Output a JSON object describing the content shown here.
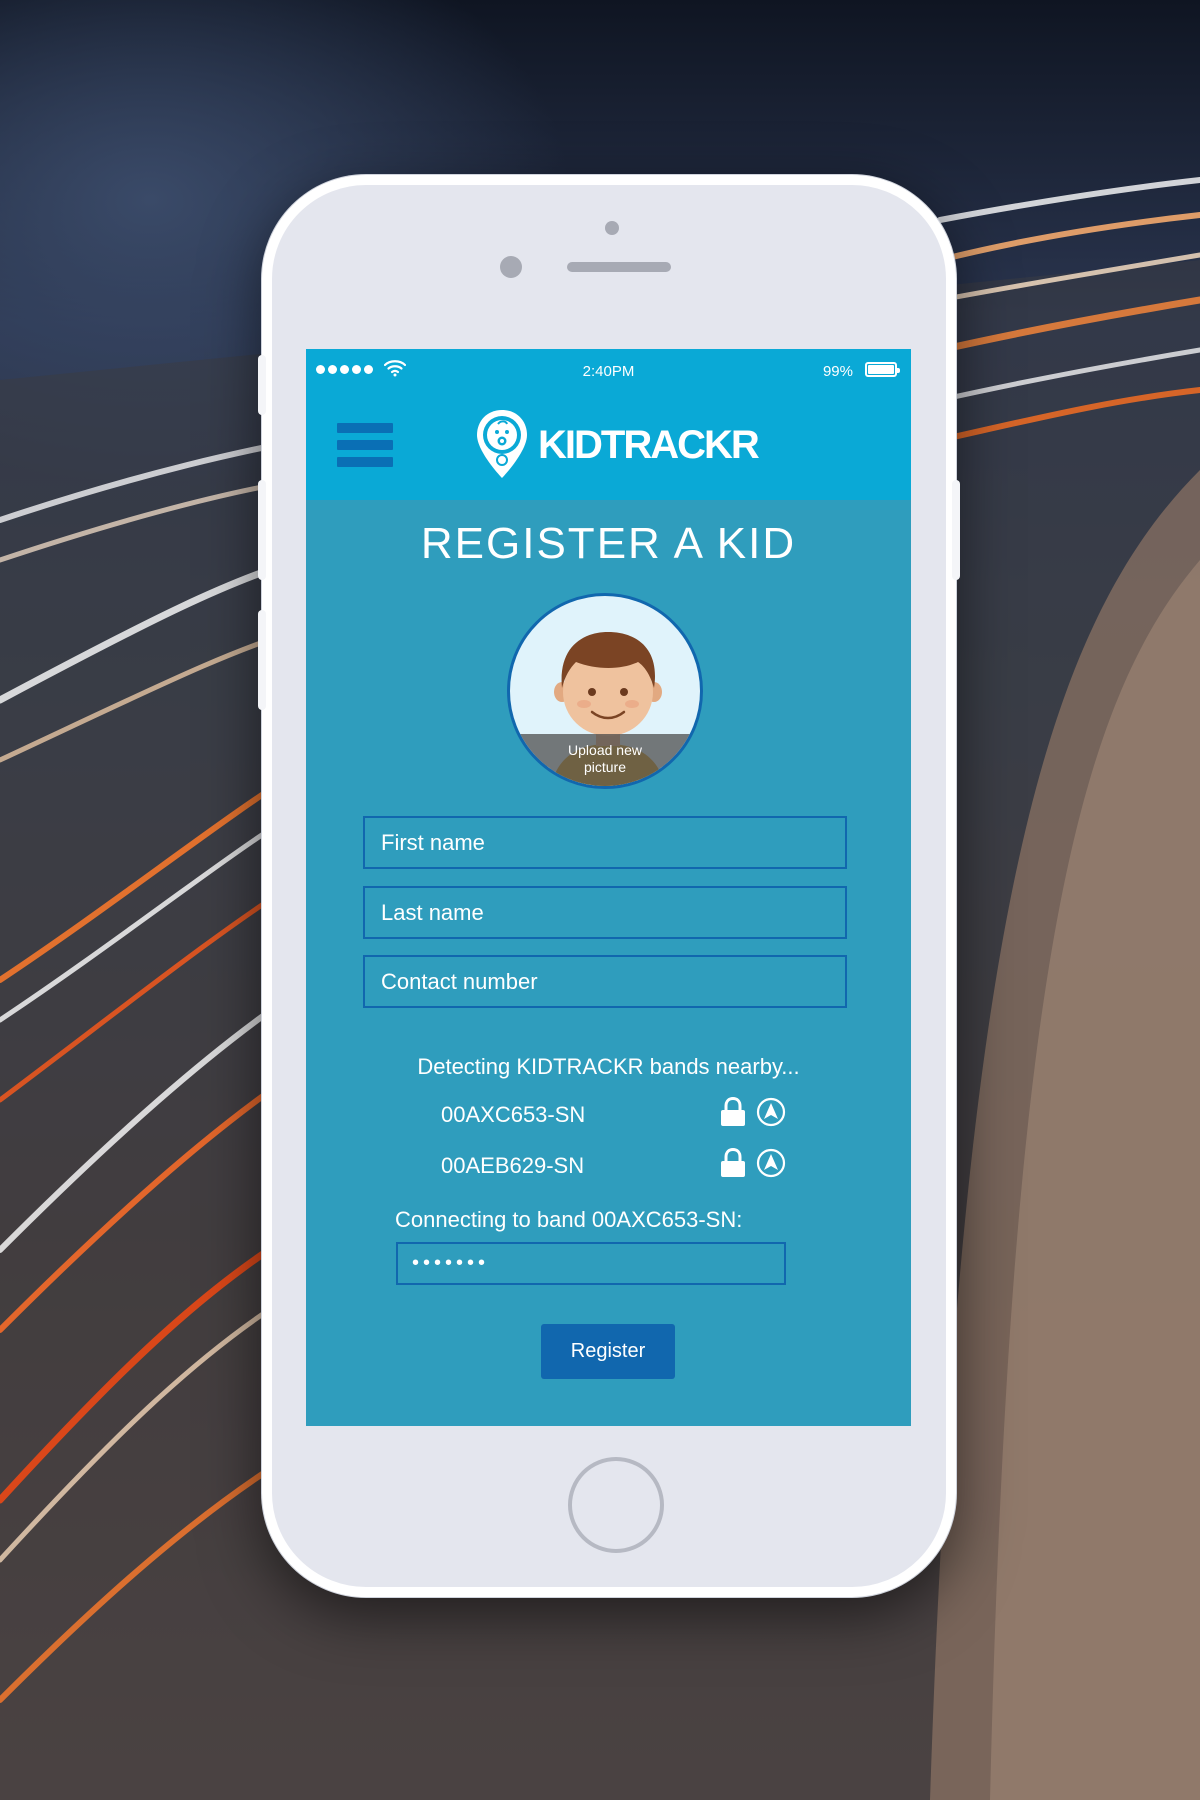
{
  "status_bar": {
    "time": "2:40PM",
    "battery": "99%",
    "battery_level": 0.99
  },
  "header": {
    "app_name": "KIDTRACKR"
  },
  "page": {
    "title": "REGISTER A KID"
  },
  "avatar": {
    "upload_label": "Upload new picture"
  },
  "form": {
    "first_name_placeholder": "First name",
    "last_name_placeholder": "Last name",
    "contact_placeholder": "Contact number"
  },
  "bands": {
    "detecting_text": "Detecting KIDTRACKR bands nearby...",
    "items": [
      {
        "id": "00AXC653-SN"
      },
      {
        "id": "00AEB629-SN"
      }
    ]
  },
  "connection": {
    "label": "Connecting to band 00AXC653-SN:",
    "password_value": "•••••••"
  },
  "actions": {
    "register_label": "Register"
  },
  "colors": {
    "screen_bg": "#2f9dbd",
    "header_bg": "#0aa9d6",
    "accent": "#1167ae",
    "phone_body": "#e4e6ee"
  }
}
